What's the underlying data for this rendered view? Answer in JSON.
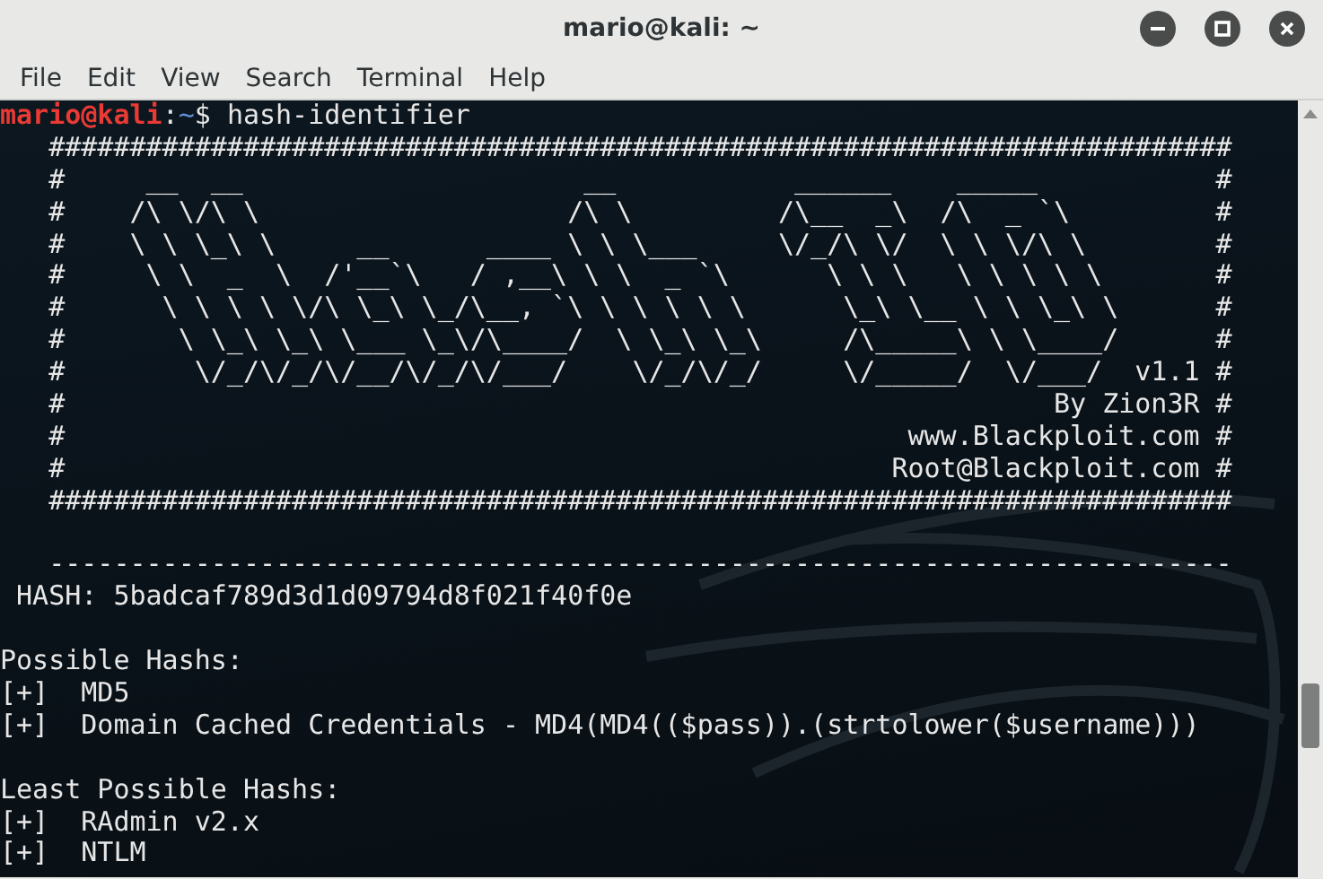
{
  "window": {
    "title": "mario@kali: ~"
  },
  "menu": [
    "File",
    "Edit",
    "View",
    "Search",
    "Terminal",
    "Help"
  ],
  "terminal": {
    "lines": [
      {
        "kind": "prompt",
        "user": "mario@kali",
        "separator": ":",
        "path": "~",
        "symbol": "$",
        "command": "hash-identifier"
      },
      {
        "kind": "text",
        "text": "   #########################################################################"
      },
      {
        "kind": "text",
        "text": "   #     __  __                     __           ______    _____           #"
      },
      {
        "kind": "text",
        "text": "   #    /\\ \\/\\ \\                   /\\ \\         /\\__  _\\  /\\  _ `\\         #"
      },
      {
        "kind": "text",
        "text": "   #    \\ \\ \\_\\ \\     __      ____ \\ \\ \\___     \\/_/\\ \\/  \\ \\ \\/\\ \\        #"
      },
      {
        "kind": "text",
        "text": "   #     \\ \\  _  \\  /'__`\\   / ,__\\ \\ \\  _ `\\      \\ \\ \\   \\ \\ \\ \\ \\       #"
      },
      {
        "kind": "text",
        "text": "   #      \\ \\ \\ \\ \\/\\ \\_\\ \\_/\\__, `\\ \\ \\ \\ \\ \\      \\_\\ \\__ \\ \\ \\_\\ \\      #"
      },
      {
        "kind": "text",
        "text": "   #       \\ \\_\\ \\_\\ \\___ \\_\\/\\____/  \\ \\_\\ \\_\\     /\\_____\\ \\ \\____/      #"
      },
      {
        "kind": "text",
        "text": "   #        \\/_/\\/_/\\/__/\\/_/\\/___/    \\/_/\\/_/     \\/_____/  \\/___/  v1.1 #"
      },
      {
        "kind": "text",
        "text": "   #                                                             By Zion3R #"
      },
      {
        "kind": "text",
        "text": "   #                                                    www.Blackploit.com #"
      },
      {
        "kind": "text",
        "text": "   #                                                   Root@Blackploit.com #"
      },
      {
        "kind": "text",
        "text": "   #########################################################################"
      },
      {
        "kind": "blank"
      },
      {
        "kind": "text",
        "text": "   -------------------------------------------------------------------------"
      },
      {
        "kind": "text",
        "text": " HASH: 5badcaf789d3d1d09794d8f021f40f0e"
      },
      {
        "kind": "blank"
      },
      {
        "kind": "text",
        "text": "Possible Hashs:"
      },
      {
        "kind": "text",
        "text": "[+]  MD5"
      },
      {
        "kind": "text",
        "text": "[+]  Domain Cached Credentials - MD4(MD4(($pass)).(strtolower($username)))"
      },
      {
        "kind": "blank"
      },
      {
        "kind": "text",
        "text": "Least Possible Hashs:"
      },
      {
        "kind": "text",
        "text": "[+]  RAdmin v2.x"
      },
      {
        "kind": "text",
        "text": "[+]  NTLM"
      }
    ]
  }
}
